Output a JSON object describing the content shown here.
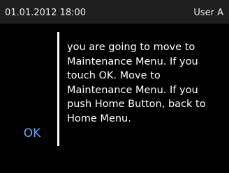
{
  "status_bar": {
    "datetime": "01.01.2012 18:00",
    "user": "User A"
  },
  "dialog": {
    "ok_label": "OK",
    "message": "you are going to move to Maintenance Menu. If you touch OK. Move to Maintenance Menu. If you push Home Button, back to Home Menu."
  },
  "colors": {
    "background": "#000000",
    "status_bar": "#1e1e1e",
    "text": "#ffffff",
    "accent": "#5aa7ff"
  }
}
